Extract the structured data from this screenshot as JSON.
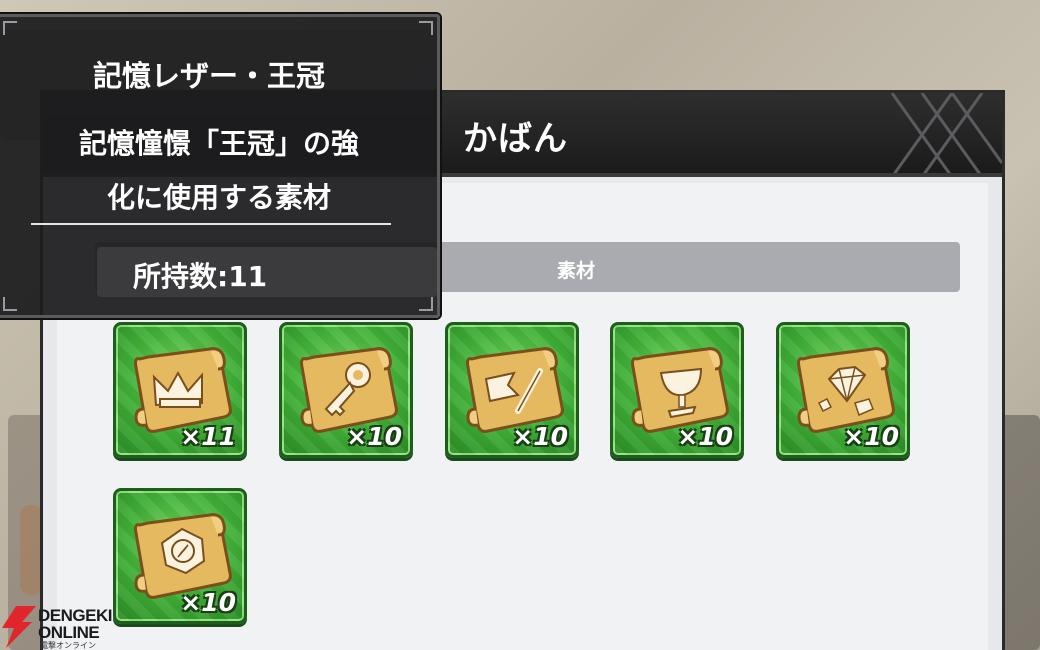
{
  "bag": {
    "title": "かばん",
    "category_label": "素材"
  },
  "tooltip": {
    "title": "記憶レザー・王冠",
    "description_line1": "記憶憧憬「王冠」の強",
    "description_line2": "化に使用する素材",
    "count_text": "所持数:11"
  },
  "items": [
    {
      "icon": "crown-scroll-icon",
      "count": "×11"
    },
    {
      "icon": "key-scroll-icon",
      "count": "×10"
    },
    {
      "icon": "flag-scroll-icon",
      "count": "×10"
    },
    {
      "icon": "chalice-scroll-icon",
      "count": "×10"
    },
    {
      "icon": "gem-scroll-icon",
      "count": "×10"
    },
    {
      "icon": "compass-scroll-icon",
      "count": "×10"
    }
  ],
  "watermark": {
    "line1": "DENGEKI",
    "line2": "ONLINE",
    "line3": "電撃オンライン"
  },
  "colors": {
    "tile_green": "#3fae36",
    "panel_header": "#1b1b1b",
    "tooltip_bg": "#1c1c1e",
    "watermark_red": "#e0262a"
  }
}
